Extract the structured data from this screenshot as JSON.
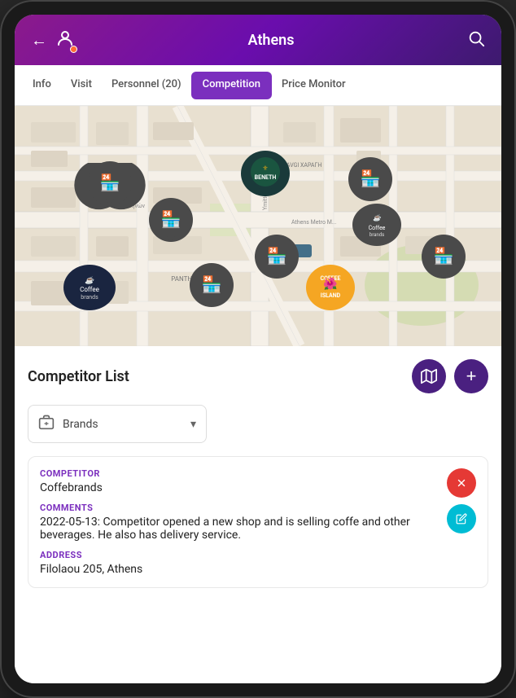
{
  "header": {
    "title": "Athens",
    "back_label": "←",
    "search_label": "🔍"
  },
  "tabs": [
    {
      "id": "info",
      "label": "Info",
      "active": false
    },
    {
      "id": "visit",
      "label": "Visit",
      "active": false
    },
    {
      "id": "personnel",
      "label": "Personnel (20)",
      "active": false
    },
    {
      "id": "competition",
      "label": "Competition",
      "active": true
    },
    {
      "id": "price-monitor",
      "label": "Price Monitor",
      "active": false
    }
  ],
  "map": {
    "pins": [
      {
        "id": "pin1",
        "type": "gray",
        "label": "store"
      },
      {
        "id": "pin2",
        "type": "gray",
        "label": "store"
      },
      {
        "id": "pin3",
        "type": "dark-green",
        "label": "BENETH"
      },
      {
        "id": "pin4",
        "type": "gray",
        "label": "store"
      },
      {
        "id": "pin5",
        "type": "gray",
        "label": "Coffeebrands"
      },
      {
        "id": "pin6",
        "type": "gray",
        "label": "store"
      },
      {
        "id": "pin7",
        "type": "gray",
        "label": "store"
      },
      {
        "id": "pin8",
        "type": "gray",
        "label": "store"
      },
      {
        "id": "pin9",
        "type": "dark-navy",
        "label": "Coffeebrands"
      },
      {
        "id": "pin10",
        "type": "orange",
        "label": "COFFEE ISLAND"
      }
    ]
  },
  "competitor_list": {
    "title": "Competitor List",
    "map_btn_label": "🗺",
    "add_btn_label": "+",
    "brands_filter": {
      "label": "Brands",
      "icon": "🏪"
    },
    "competitors": [
      {
        "id": "comp1",
        "competitor_label": "COMPETITOR",
        "competitor_value": "Coffebrands",
        "comments_label": "COMMENTS",
        "comments_value": "2022-05-13: Competitor opened a new shop and is selling coffe and other beverages. He also has delivery service.",
        "address_label": "ADDRESS",
        "address_value": "Filolaou 205, Athens"
      }
    ]
  },
  "colors": {
    "primary": "#7B2FBE",
    "header_gradient_start": "#8B1A8B",
    "header_gradient_end": "#3D1A6E",
    "delete_btn": "#e53935",
    "edit_btn": "#00bcd4",
    "map_action": "#4a2080",
    "pin_gray": "#4a4a4a",
    "pin_dark_green": "#1a3a3a",
    "pin_orange": "#f5a623",
    "pin_dark_navy": "#1a2540"
  }
}
